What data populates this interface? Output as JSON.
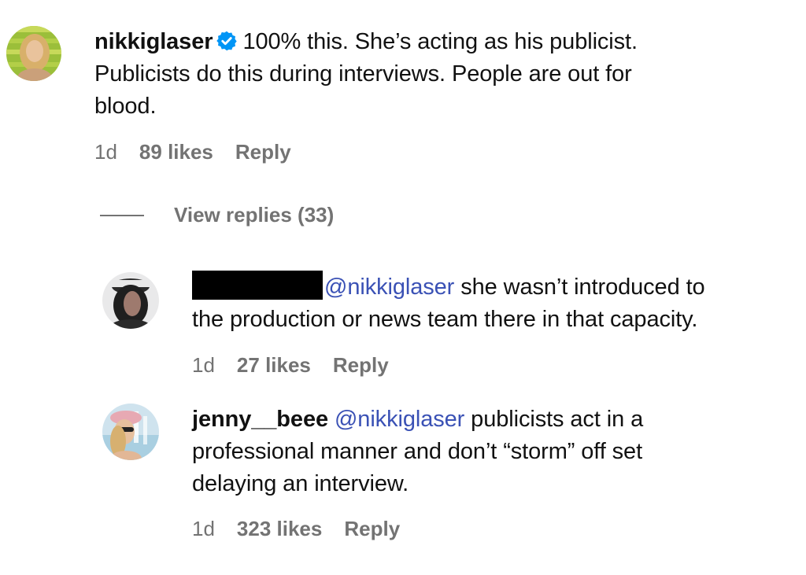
{
  "comments": [
    {
      "username": "nikkiglaser",
      "verified": true,
      "text_lines": [
        "100% this. She’s acting as his publicist.",
        "Publicists do this during interviews. People are out for",
        "blood."
      ],
      "time": "1d",
      "likes": "89 likes",
      "reply": "Reply"
    }
  ],
  "view_replies": "View replies (33)",
  "replies": [
    {
      "username": "",
      "redacted": true,
      "mention": "@nikkiglaser",
      "text_line1": " she wasn’t introduced to",
      "text_line2": "the production or news team there in that capacity.",
      "time": "1d",
      "likes": "27 likes",
      "reply": "Reply"
    },
    {
      "username": "jenny__beee",
      "mention": "@nikkiglaser",
      "text_line1": " publicists act in a",
      "text_line2": "professional manner and don’t “storm” off set",
      "text_line3": "delaying an interview.",
      "time": "1d",
      "likes": "323 likes",
      "reply": "Reply"
    }
  ],
  "colors": {
    "mention": "#3a51b5",
    "meta": "#737373",
    "verified": "#0095f6"
  }
}
